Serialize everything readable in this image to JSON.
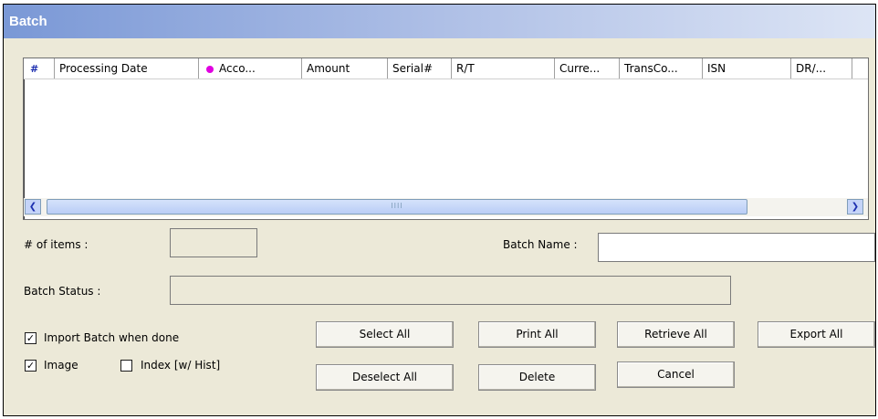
{
  "window": {
    "title": "Batch"
  },
  "list": {
    "columns": [
      {
        "label": "",
        "icon": "hash-icon"
      },
      {
        "label": "Processing Date"
      },
      {
        "label": "Acco...",
        "icon": "magenta-dot-icon"
      },
      {
        "label": "Amount"
      },
      {
        "label": "Serial#"
      },
      {
        "label": "R/T"
      },
      {
        "label": "Curre..."
      },
      {
        "label": "TransCo..."
      },
      {
        "label": "ISN"
      },
      {
        "label": "DR/..."
      }
    ],
    "rows": [],
    "scroll_thumb_text": "IIII"
  },
  "form": {
    "items_label": "# of items :",
    "items_value": "",
    "batch_name_label": "Batch Name :",
    "batch_name_value": "",
    "batch_status_label": "Batch Status :",
    "batch_status_value": ""
  },
  "options": {
    "import_batch": {
      "label": "Import Batch when done",
      "checked": true
    },
    "image": {
      "label": "Image",
      "checked": true
    },
    "index_hist": {
      "label": "Index [w/ Hist]",
      "checked": false
    }
  },
  "buttons": {
    "select_all": "Select All",
    "print_all": "Print All",
    "retrieve_all": "Retrieve All",
    "export_all": "Export All",
    "deselect_all": "Deselect All",
    "delete": "Delete",
    "cancel": "Cancel"
  },
  "colors": {
    "title_bar_start": "#7a98d6",
    "dialog_bg": "#ece9d8",
    "accent_dot": "#e000e0"
  }
}
